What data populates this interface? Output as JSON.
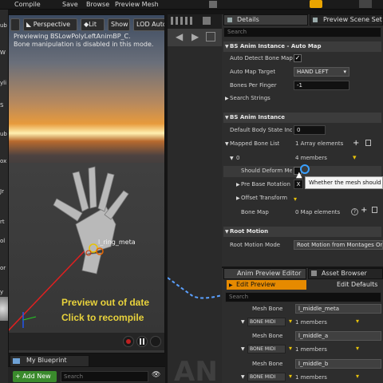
{
  "menubar": {
    "items": [
      "Compile",
      "Save",
      "Browse",
      "Preview Mesh"
    ]
  },
  "left_edge": {
    "fragments": [
      "ub",
      "W",
      "yli",
      "S",
      "ub",
      "ox",
      "Jr",
      "rt",
      "ol",
      "or",
      "y"
    ]
  },
  "viewport": {
    "toolbar": {
      "perspective": "Perspective",
      "lit": "Lit",
      "show": "Show",
      "lod": "LOD Auto"
    },
    "message_line1": "Previewing BSLowPolyLeftAnimBP_C.",
    "message_line2": "Bone manipulation is disabled in this mode.",
    "bone_label": "l_ring_meta",
    "out_of_date_line1": "Preview out of date",
    "out_of_date_line2": "Click to recompile"
  },
  "my_blueprint": {
    "tab_label": "My Blueprint",
    "add_new": "+ Add New",
    "search_placeholder": "Search"
  },
  "graph": {
    "watermark": "AN"
  },
  "details": {
    "tab_details": "Details",
    "tab_preview": "Preview Scene Sett",
    "search_placeholder": "Search",
    "cat_automap": "BS Anim Instance - Auto Map",
    "auto_detect_label": "Auto Detect Bone Map",
    "auto_detect_value": "✓",
    "auto_map_target_label": "Auto Map Target",
    "auto_map_target_value": "HAND LEFT",
    "bones_per_finger_label": "Bones Per Finger",
    "bones_per_finger_value": "-1",
    "search_strings_label": "Search Strings",
    "cat_anim": "BS Anim Instance",
    "default_body_label": "Default Body State Inde",
    "default_body_value": "0",
    "mapped_bone_list_label": "Mapped Bone List",
    "mapped_bone_list_value": "1 Array elements",
    "index0_label": "0",
    "index0_value": "4 members",
    "should_deform_label": "Should Deform Me",
    "tooltip": "Whether the mesh should d",
    "pre_base_rotation_label": "Pre Base Rotation",
    "pre_base_rotation_value": "X",
    "offset_transform_label": "Offset Transform",
    "bone_map_label": "Bone Map",
    "bone_map_value": "0 Map elements",
    "cat_root_motion": "Root Motion",
    "root_motion_mode_label": "Root Motion Mode",
    "root_motion_mode_value": "Root Motion from Montages Onl"
  },
  "anim_preview": {
    "tab_editor": "Anim Preview Editor",
    "tab_browser": "Asset Browser",
    "edit_preview": "Edit Preview",
    "edit_defaults": "Edit Defaults",
    "search_placeholder": "Search",
    "mesh_bone_label": "Mesh Bone",
    "row1_value": "l_middle_meta",
    "bone_mid_label": "BONE MIDI",
    "members": "1 members",
    "row2_value": "l_middle_a",
    "row3_value": "l_middle_b"
  }
}
